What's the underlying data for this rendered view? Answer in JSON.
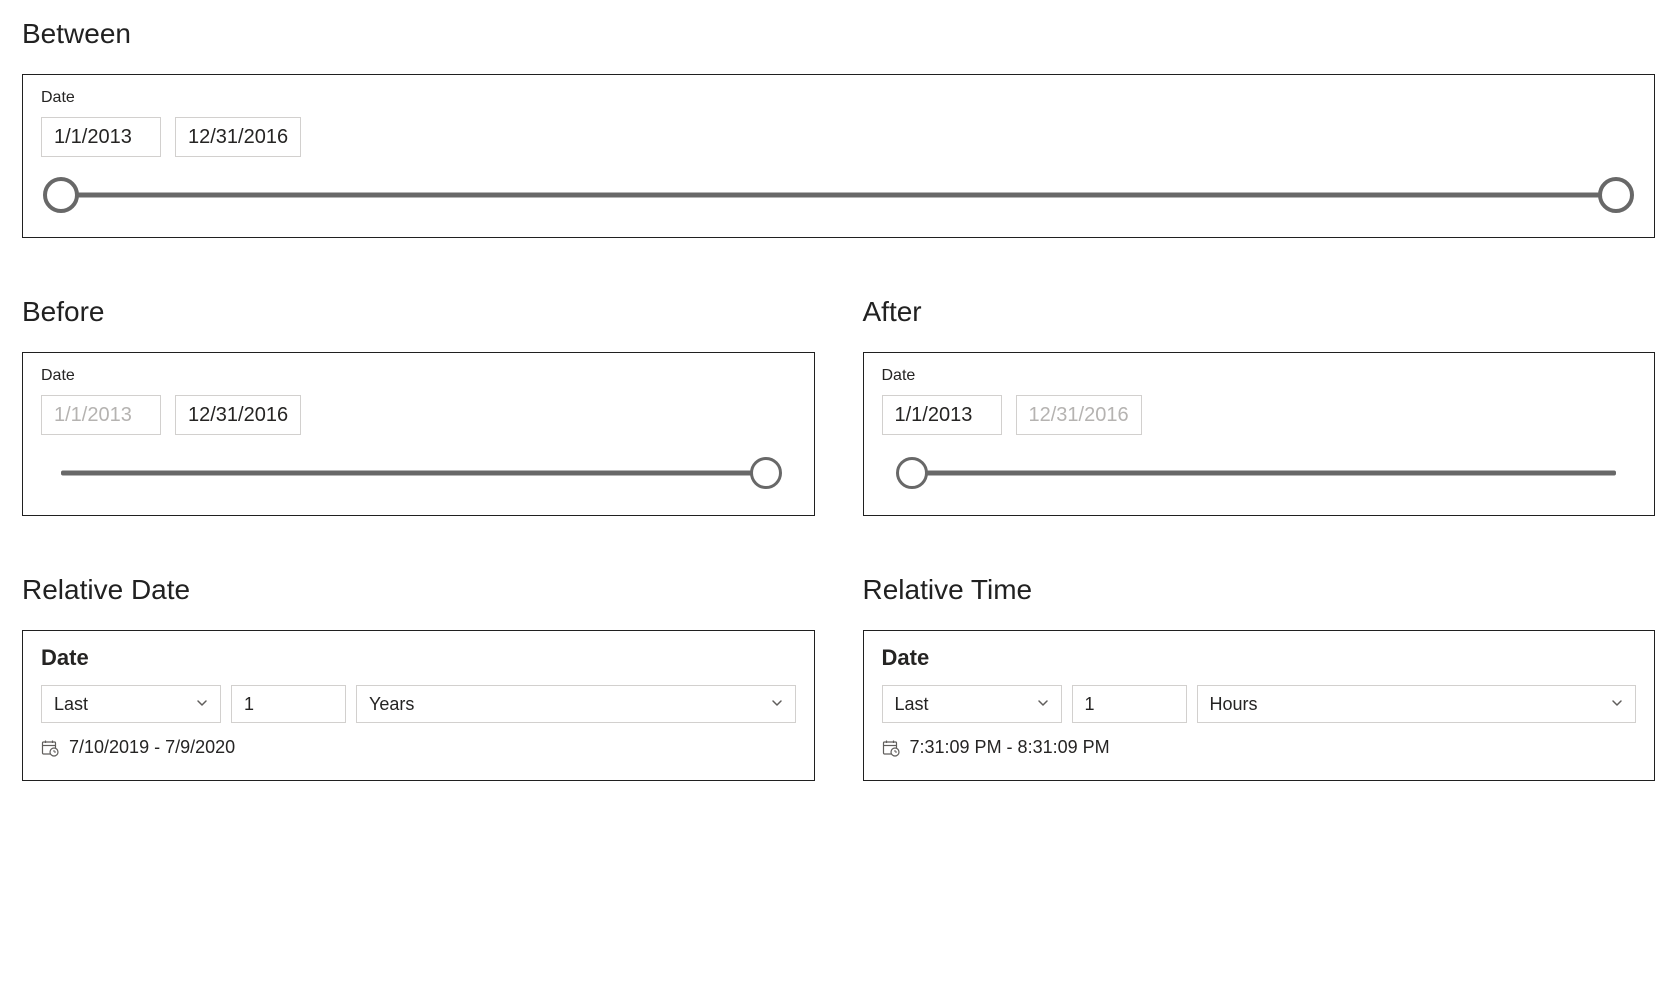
{
  "between": {
    "title": "Between",
    "label": "Date",
    "start": "1/1/2013",
    "end": "12/31/2016"
  },
  "before": {
    "title": "Before",
    "label": "Date",
    "start": "1/1/2013",
    "end": "12/31/2016"
  },
  "after": {
    "title": "After",
    "label": "Date",
    "start": "1/1/2013",
    "end": "12/31/2016"
  },
  "relativeDate": {
    "title": "Relative Date",
    "label": "Date",
    "mode": "Last",
    "count": "1",
    "unit": "Years",
    "range": "7/10/2019 - 7/9/2020"
  },
  "relativeTime": {
    "title": "Relative Time",
    "label": "Date",
    "mode": "Last",
    "count": "1",
    "unit": "Hours",
    "range": "7:31:09 PM - 8:31:09 PM"
  }
}
